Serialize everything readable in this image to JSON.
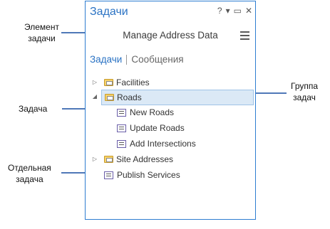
{
  "pane": {
    "title": "Задачи",
    "buttons": {
      "help": "?",
      "menu": "▾",
      "restore": "▭",
      "close": "✕"
    },
    "task_item_name": "Manage Address Data",
    "tabs": [
      {
        "label": "Задачи",
        "active": true
      },
      {
        "label": "Сообщения",
        "active": false
      }
    ],
    "tree": [
      {
        "label": "Facilities"
      },
      {
        "label": "Roads"
      },
      {
        "label": "New Roads"
      },
      {
        "label": "Update Roads"
      },
      {
        "label": "Add Intersections"
      },
      {
        "label": "Site Addresses"
      },
      {
        "label": "Publish Services"
      }
    ]
  },
  "annotations": {
    "task_item": [
      "Элемент",
      "задачи"
    ],
    "task": "Задача",
    "task_group": [
      "Группа",
      "задач"
    ],
    "single_task": [
      "Отдельная",
      "задача"
    ]
  },
  "colors": {
    "accent": "#2b73c4",
    "callout": "#4f78b8",
    "selection": "#dbe9f6"
  }
}
